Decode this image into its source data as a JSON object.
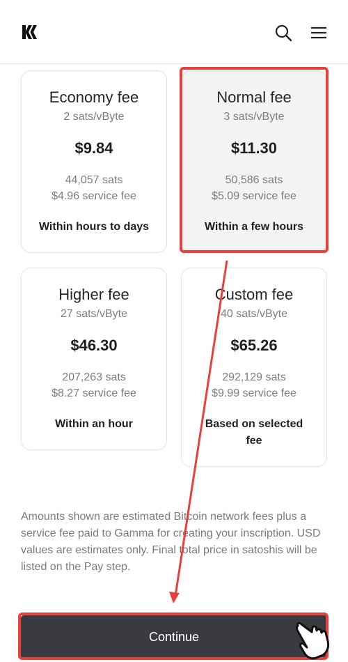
{
  "header": {
    "logo_icon": "gamma-logo-icon",
    "search_icon": "search-icon",
    "menu_icon": "hamburger-menu-icon"
  },
  "fees": [
    {
      "title": "Economy fee",
      "rate": "2 sats/vByte",
      "price": "$9.84",
      "sats": "44,057 sats",
      "service": "$4.96 service fee",
      "time": "Within hours to days",
      "selected": false
    },
    {
      "title": "Normal fee",
      "rate": "3 sats/vByte",
      "price": "$11.30",
      "sats": "50,586 sats",
      "service": "$5.09 service fee",
      "time": "Within a few hours",
      "selected": true
    },
    {
      "title": "Higher fee",
      "rate": "27 sats/vByte",
      "price": "$46.30",
      "sats": "207,263 sats",
      "service": "$8.27 service fee",
      "time": "Within an hour",
      "selected": false
    },
    {
      "title": "Custom fee",
      "rate": "40 sats/vByte",
      "price": "$65.26",
      "sats": "292,129 sats",
      "service": "$9.99 service fee",
      "time": "Based on selected fee",
      "selected": false
    }
  ],
  "disclaimer": "Amounts shown are estimated Bitcoin network fees plus a service fee paid to Gamma for creating your inscription. USD values are estimates only. Final total price in satoshis will be listed on the Pay step.",
  "continue_label": "Continue",
  "colors": {
    "highlight": "#e8403a",
    "button": "#3a3b40"
  }
}
